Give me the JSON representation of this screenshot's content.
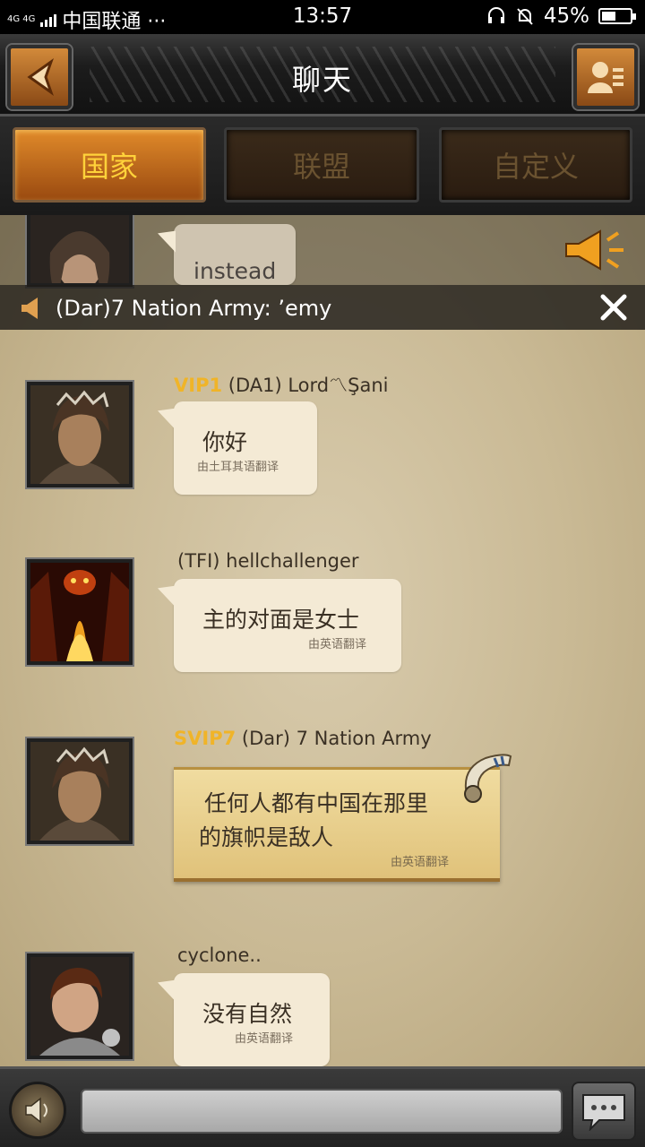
{
  "status_bar": {
    "network": "4G 4G",
    "carrier": "中国联通 ···",
    "time": "13:57",
    "battery": "45%",
    "battery_level": 0.45
  },
  "header": {
    "title": "聊天"
  },
  "tabs": [
    {
      "label": "国家",
      "active": true
    },
    {
      "label": "联盟",
      "active": false
    },
    {
      "label": "自定义",
      "active": false
    }
  ],
  "announcement": {
    "text": "(Dar)7 Nation Army: ’emy"
  },
  "messages": [
    {
      "vip": "",
      "sender": "",
      "text": "instead",
      "translation": ""
    },
    {
      "vip": "VIP1",
      "sender": "(DA1) Lord〽Şani",
      "text": "你好",
      "translation": "由土耳其语翻译"
    },
    {
      "vip": "",
      "sender": "(TFI) hellchallenger",
      "text": "主的对面是女士",
      "translation": "由英语翻译"
    },
    {
      "vip": "SVIP7",
      "sender": "(Dar) 7 Nation Army",
      "text_line1": "任何人都有中国在那里",
      "text_line2": "的旗帜是敌人",
      "translation": "由英语翻译"
    },
    {
      "vip": "",
      "sender": "cyclone..",
      "text": "没有自然",
      "translation": "由英语翻译"
    }
  ],
  "colors": {
    "vip": "#f0b428",
    "tab_active": "#ffd23a",
    "bubble": "#f4ead5"
  }
}
